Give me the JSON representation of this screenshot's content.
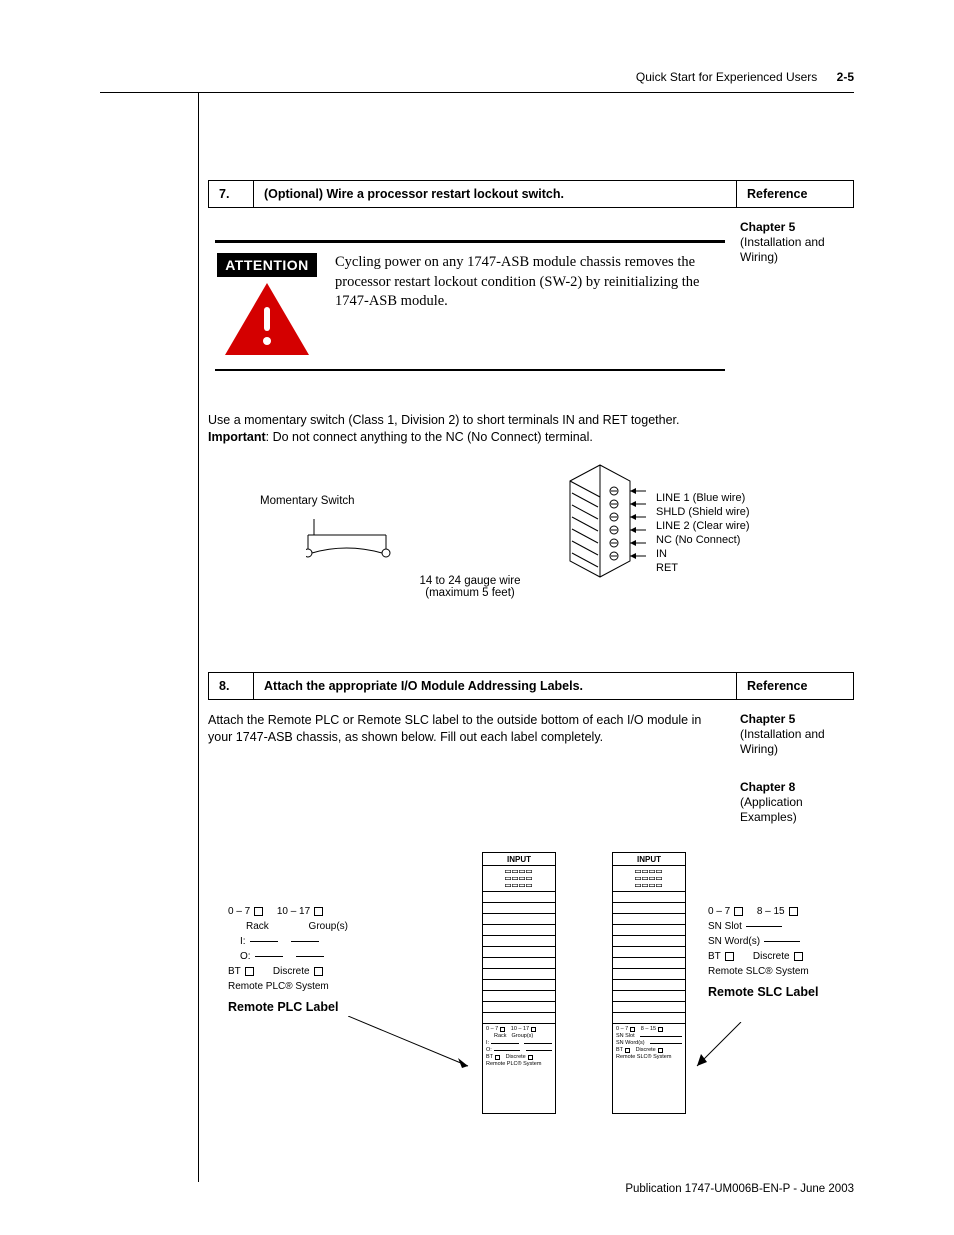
{
  "header": {
    "running": "Quick Start for Experienced Users",
    "pagenum": "2-5"
  },
  "step7": {
    "num": "7.",
    "title": "(Optional)  Wire a processor restart lockout switch.",
    "ref_header": "Reference",
    "ref_chapter": "Chapter 5",
    "ref_desc": "(Installation and Wiring)",
    "attention_label": "ATTENTION",
    "attention_text": "Cycling power on any 1747-ASB module chassis removes the processor restart lockout condition (SW-2) by reinitializing the 1747-ASB module.",
    "para1": "Use a momentary switch (Class 1, Division 2) to short terminals IN and RET together.",
    "para2a": "Important",
    "para2b": ": Do not connect anything to the NC (No Connect) terminal.",
    "switch_label": "Momentary Switch",
    "gauge_l1": "14 to 24 gauge wire",
    "gauge_l2": "(maximum 5 feet)",
    "wire1": "LINE 1 (Blue wire)",
    "wire2": "SHLD (Shield wire)",
    "wire3": "LINE 2 (Clear wire)",
    "wire4": "NC (No Connect)",
    "wire5": "IN",
    "wire6": "RET"
  },
  "step8": {
    "num": "8.",
    "title": "Attach the appropriate I/O Module Addressing Labels.",
    "ref_header": "Reference",
    "para": "Attach the Remote PLC or Remote SLC label to the outside bottom of each I/O module in your 1747-ASB chassis, as shown below.  Fill out each label completely.",
    "ref1_chapter": "Chapter 5",
    "ref1_desc": "(Installation and Wiring)",
    "ref2_chapter": "Chapter 8",
    "ref2_desc": "(Application Examples)",
    "module_head": "INPUT",
    "plc": {
      "range1": "0 – 7",
      "range2": "10 – 17",
      "rack": "Rack",
      "groups": "Group(s)",
      "i": "I:",
      "o": "O:",
      "bt": "BT",
      "discrete": "Discrete",
      "system": "Remote PLC® System",
      "title": "Remote PLC Label"
    },
    "slc": {
      "range1": "0 – 7",
      "range2": "8 – 15",
      "snslot": "SN Slot",
      "snword": "SN Word(s)",
      "bt": "BT",
      "discrete": "Discrete",
      "system": "Remote SLC® System",
      "title": "Remote SLC Label"
    }
  },
  "footer": "Publication 1747-UM006B-EN-P - June 2003"
}
